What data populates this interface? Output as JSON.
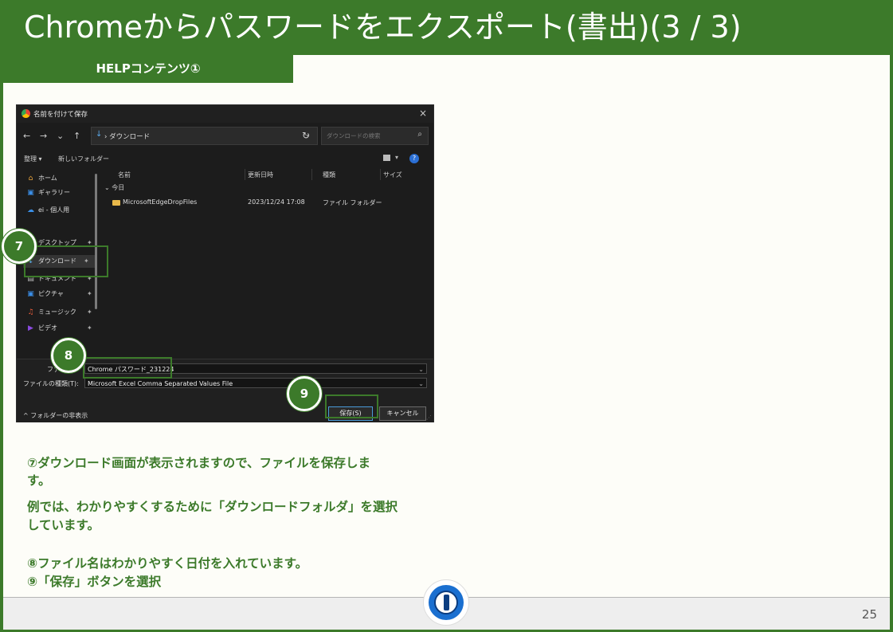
{
  "header": {
    "title": "Chromeからパスワードをエクスポート(書出)(3 / 3)"
  },
  "subtitle": {
    "label": "HELPコンテンツ①"
  },
  "dialog": {
    "title": "名前を付けて保存",
    "close": "×",
    "nav": {
      "back": "←",
      "forward": "→",
      "down": "⌄",
      "up": "↑"
    },
    "breadcrumb": "› ダウンロード",
    "search_placeholder": "ダウンロードの検索",
    "toolbar": {
      "organize": "整理 ▾",
      "new_folder": "新しいフォルダー",
      "help": "?"
    },
    "sidebar": [
      {
        "icon": "home-icon",
        "label": "ホーム",
        "glyph": "⌂",
        "color": "#e8a33c"
      },
      {
        "icon": "gallery-icon",
        "label": "ギャラリー",
        "glyph": "▣",
        "color": "#3a8ee6"
      },
      {
        "icon": "onedrive-icon",
        "label": "ei - 個人用",
        "glyph": "☁",
        "color": "#3a8ee6"
      },
      {
        "icon": "desktop-icon",
        "label": "デスクトップ",
        "glyph": "▬",
        "color": "#3a8ee6"
      },
      {
        "icon": "download-icon",
        "label": "ダウンロード",
        "glyph": "↓",
        "color": "#5ba8e8"
      },
      {
        "icon": "document-icon",
        "label": "ドキュメント",
        "glyph": "▤",
        "color": "#bbbbbb"
      },
      {
        "icon": "pictures-icon",
        "label": "ピクチャ",
        "glyph": "▣",
        "color": "#3a8ee6"
      },
      {
        "icon": "music-icon",
        "label": "ミュージック",
        "glyph": "♫",
        "color": "#e85c3a"
      },
      {
        "icon": "video-icon",
        "label": "ビデオ",
        "glyph": "▶",
        "color": "#8a4ae0"
      }
    ],
    "columns": {
      "name": "名前",
      "date": "更新日時",
      "type": "種類",
      "size": "サイズ"
    },
    "group_label": "⌄ 今日",
    "files": [
      {
        "name": "MicrosoftEdgeDropFiles",
        "date": "2023/12/24 17:08",
        "type": "ファイル フォルダー"
      }
    ],
    "filename_label": "ファ",
    "filename_value": "Chrome パスワード_231224",
    "filetype_label": "ファイルの種類(T):",
    "filetype_value": "Microsoft Excel Comma Separated Values File",
    "hide_folders": "^ フォルダーの非表示",
    "save_button": "保存(S)",
    "cancel_button": "キャンセル"
  },
  "callouts": {
    "seven": "7",
    "eight": "8",
    "nine": "9"
  },
  "body": {
    "line1": "⑦ダウンロード画面が表示されますので、ファイルを保存しま",
    "line2": "す。",
    "line3": "例では、わかりやすくするために「ダウンロードフォルダ」を選択",
    "line4": "しています。",
    "line5": "⑧ファイル名はわかりやすく日付を入れています。",
    "line6": "⑨「保存」ボタンを選択"
  },
  "footer": {
    "page_number": "25"
  },
  "colors": {
    "brand_green": "#3c7a2a",
    "slide_bg": "#fdfdf8",
    "dialog_bg": "#1c1c1c"
  }
}
